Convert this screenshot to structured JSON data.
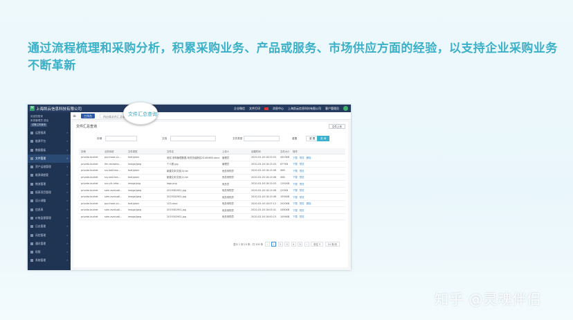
{
  "headline": "通过流程梳理和采购分析，积累采购业务、产品或服务、市场供应方面的经验，以支持企业采购业务不断革新",
  "app": {
    "title": "上海凯云信息科技有限公司",
    "logo_letter": "M",
    "topbar_links": [
      "企业微信",
      "文件打印",
      "消息中心",
      "上海凯云信息科技有限公司",
      "客户管理员"
    ]
  },
  "sidebar": {
    "user_line1": "欢迎您登录",
    "user_line2": "系统管理员  退出",
    "user_button": "切换工作身份",
    "items": [
      {
        "label": "运营报表"
      },
      {
        "label": "能源平台"
      },
      {
        "label": "数据看板"
      },
      {
        "label": "文件管理",
        "active": true
      },
      {
        "label": "资产运维管理"
      },
      {
        "label": "能源调度管"
      },
      {
        "label": "物流管理"
      },
      {
        "label": "报表项目管理"
      },
      {
        "label": "设计调整"
      },
      {
        "label": "信息表"
      },
      {
        "label": "价格监督管理"
      },
      {
        "label": "日志管理"
      },
      {
        "label": "风险管理"
      },
      {
        "label": "通讯管理"
      },
      {
        "label": "权限"
      },
      {
        "label": "系统管理"
      }
    ]
  },
  "tabs": {
    "home": "工作台",
    "current": "供应商文件汇总查询"
  },
  "magnifier_label": "文件汇总查询",
  "panel": {
    "title": "文件汇总查询",
    "export_button": "文件上传"
  },
  "filters": {
    "label1": "存储",
    "label2": "文档",
    "label3": "文件类型",
    "reset": "重置",
    "reset2": "重 置",
    "search": "查 询"
  },
  "table": {
    "headers": [
      "存储",
      "业务系统",
      "文件类型",
      "文件名",
      "上传人",
      "创建时间",
      "文件大小",
      "操作"
    ],
    "rows": [
      [
        "private-bucket",
        "purchase-cx...",
        "text/plain",
        "测试-采购管理数据-年终总结报告20180605.docx",
        "管理员",
        "2020-03-16 18:25:03",
        "4003KB",
        [
          "下载",
          "预览",
          "删除"
        ]
      ],
      [
        "private-bucket",
        "lfm-receptio...",
        "image/jpeg",
        "个人照.jpg",
        "管理员",
        "2020-03-16 18:13:03",
        "877KB",
        [
          "下载",
          "预览"
        ]
      ],
      [
        "private-bucket",
        "scv-bid-hea...",
        "text/plain",
        "新建文本文档(3).txt",
        "倪总采购员",
        "2020-03-16 18:13:08",
        "0KB",
        [
          "下载",
          "预览"
        ]
      ],
      [
        "private-bucket",
        "scv-bid-hea...",
        "text/plain",
        "新建文本文档(2).txt",
        "倪总采购员",
        "2020-03-16 18:13:08",
        "0KB",
        [
          "下载",
          "预览"
        ]
      ],
      [
        "private-bucket",
        "scv-cfc-infor...",
        "image/png",
        "logo.png",
        "倪总员",
        "2020-03-16 18:13:03",
        "1191KB",
        [
          "下载",
          "预览"
        ]
      ],
      [
        "private-bucket",
        "sdm-evaluati...",
        "image/jpeg",
        "2019081901.jpg",
        "倪总采购员",
        "2020-03-16 18:13:06",
        "225KB",
        [
          "下载",
          "预览"
        ]
      ],
      [
        "private-bucket",
        "sdm-evaluati...",
        "image/jpeg",
        "2019342902.jpg",
        "倪总采购员",
        "2020-03-16 18:13:06",
        "1094KB",
        [
          "下载",
          "预览"
        ]
      ],
      [
        "private-bucket",
        "purchase-cx...",
        "text/plain",
        "123.docx",
        "倪总采购员",
        "2020-03-16 18:07:12",
        "2020KB",
        [
          "下载",
          "预览",
          "删除"
        ]
      ],
      [
        "private-bucket",
        "sdm-evaluati...",
        "image/jpeg",
        "2019081901.jpg",
        "倪总采购员",
        "2020-03-16 18:03:41",
        "4360KB",
        [
          "下载",
          "预览"
        ]
      ],
      [
        "private-bucket",
        "sdm-evaluati...",
        "image/jpeg",
        "2019342902.jpg",
        "倪总采购员",
        "2020-03-16 18:00:15",
        "1094KB",
        [
          "下载",
          "预览"
        ]
      ]
    ]
  },
  "pager": {
    "summary": "显示 1 到 10 条，共 200 条",
    "pages": [
      "1",
      "2",
      "3",
      "4",
      "5"
    ],
    "current": "1",
    "goto": "前往 5",
    "size": "10 条/页"
  },
  "watermark": "知乎 @灵魂伴侣"
}
